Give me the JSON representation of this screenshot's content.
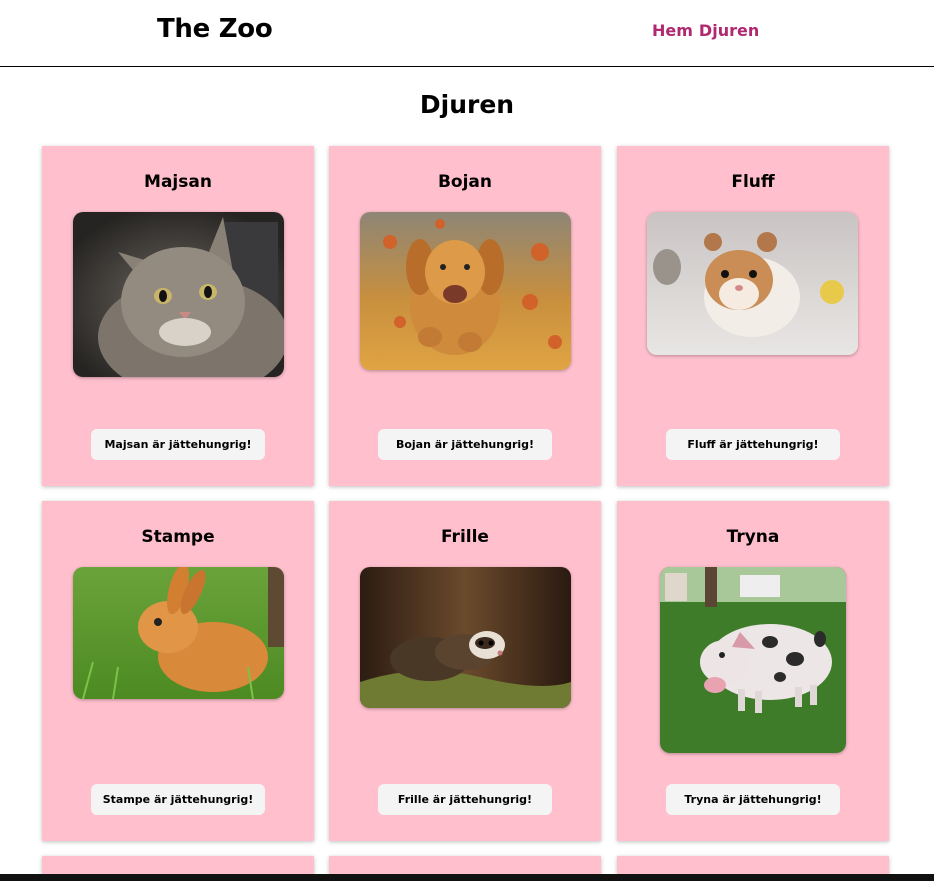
{
  "header": {
    "title": "The Zoo",
    "nav": [
      "Hem",
      "Djuren"
    ]
  },
  "page": {
    "heading": "Djuren"
  },
  "animals": [
    {
      "name": "Majsan",
      "button_label": "Majsan är jättehungrig!",
      "photo": "cat-photo"
    },
    {
      "name": "Bojan",
      "button_label": "Bojan är jättehungrig!",
      "photo": "dog-photo"
    },
    {
      "name": "Fluff",
      "button_label": "Fluff är jättehungrig!",
      "photo": "hamster-photo"
    },
    {
      "name": "Stampe",
      "button_label": "Stampe är jättehungrig!",
      "photo": "rabbit-photo"
    },
    {
      "name": "Frille",
      "button_label": "Frille är jättehungrig!",
      "photo": "ferret-photo"
    },
    {
      "name": "Tryna",
      "button_label": "Tryna är jättehungrig!",
      "photo": "pig-photo"
    }
  ],
  "colors": {
    "card": "#ffbfcd",
    "nav_link": "#b0286f",
    "button": "#f4f4f4"
  }
}
